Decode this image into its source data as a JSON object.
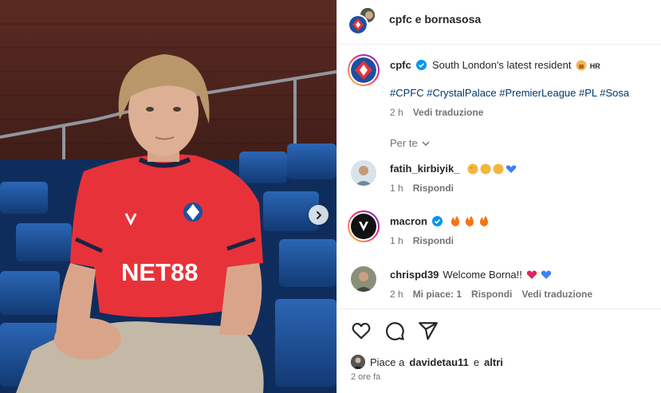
{
  "header": {
    "title": "cpfc e bornasosa"
  },
  "caption": {
    "username": "cpfc",
    "text": "South London's latest resident",
    "emoji_label": "HR",
    "hashtags": "#CPFC #CrystalPalace #PremierLeague #PL #Sosa",
    "time": "2 h",
    "translate": "Vedi traduzione"
  },
  "see_all": {
    "label": "Per te"
  },
  "comments": [
    {
      "username": "fatih_kirbiyik_",
      "text": "",
      "time": "1 h",
      "reply": "Rispondi",
      "likes": "",
      "translate": ""
    },
    {
      "username": "macron",
      "text": "",
      "time": "1 h",
      "reply": "Rispondi",
      "likes": "",
      "translate": ""
    },
    {
      "username": "chrispd39",
      "text": "Welcome Borna!!",
      "time": "2 h",
      "reply": "Rispondi",
      "likes": "Mi piace: 1",
      "translate": "Vedi traduzione"
    }
  ],
  "likes": {
    "prefix": "Piace a",
    "user": "davidetau11",
    "middle": "e",
    "others": "altri"
  },
  "timestamp": "2 ore fa",
  "photo": {
    "jersey_text": "NET88"
  },
  "colors": {
    "jersey_red": "#e8323a",
    "seat_blue": "#1e56a0",
    "hashtag": "#00376b",
    "verified": "#0095f6",
    "muted": "#737373"
  },
  "icons": [
    "chevron-right-icon",
    "verified-icon",
    "heart-icon",
    "comment-icon",
    "share-icon",
    "chevron-down-icon"
  ]
}
